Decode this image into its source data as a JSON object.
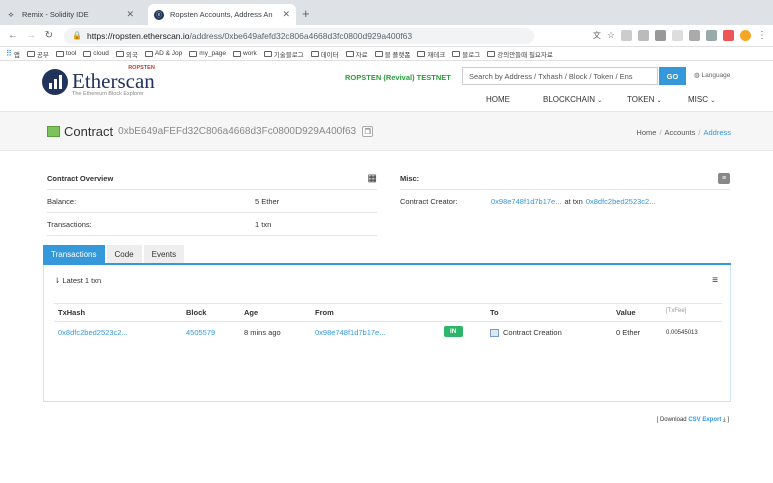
{
  "browser": {
    "tabs": [
      {
        "title": "Remix - Solidity IDE",
        "active": false
      },
      {
        "title": "Ropsten Accounts, Address An",
        "active": true
      }
    ],
    "url_host": "https://ropsten.etherscan.io",
    "url_path": "/address/0xbe649afefd32c806a4668d3fc0800d929a400f63",
    "bookmarks": [
      "앱",
      "공부",
      "tool",
      "cloud",
      "외국",
      "AD & Jop",
      "my_page",
      "work",
      "기술블로그",
      "데이터",
      "자료",
      "블 플랫폼",
      "재테크",
      "블로그",
      "강의만들때 필요자료"
    ]
  },
  "header": {
    "logo_badge": "ROPSTEN",
    "logo_name": "Etherscan",
    "logo_tagline": "The Ethereum Block Explorer",
    "network": "ROPSTEN (Revival) TESTNET",
    "search_placeholder": "Search by Address / Txhash / Block / Token / Ens",
    "go_label": "GO",
    "language": "Language",
    "nav": [
      "HOME",
      "BLOCKCHAIN",
      "TOKEN",
      "MISC"
    ]
  },
  "crumbbar": {
    "title": "Contract",
    "address": "0xbE649aFEFd32C806a4668d3Fc0800D929A400f63",
    "crumbs": [
      "Home",
      "Accounts",
      "Address"
    ]
  },
  "overview": {
    "title": "Contract Overview",
    "balance_label": "Balance:",
    "balance_value": "5 Ether",
    "tx_label": "Transactions:",
    "tx_value": "1 txn"
  },
  "misc": {
    "title": "Misc:",
    "creator_label": "Contract Creator:",
    "creator_addr": "0x98e748f1d7b17e...",
    "at_txn": "at txn",
    "creator_tx": "0x8dfc2bed2523c2..."
  },
  "tabs": [
    "Transactions",
    "Code",
    "Events"
  ],
  "txtable": {
    "latest": "Latest 1 txn",
    "headers": [
      "TxHash",
      "Block",
      "Age",
      "From",
      "To",
      "Value",
      "[TxFee]"
    ],
    "row": {
      "hash": "0x8dfc2bed2523c2...",
      "block": "4505579",
      "age": "8 mins ago",
      "from": "0x98e748f1d7b17e...",
      "direction": "IN",
      "to": "Contract Creation",
      "value": "0 Ether",
      "fee": "0.00545013"
    }
  },
  "download": {
    "prefix": "[ Download",
    "link": "CSV Export",
    "suffix": "]"
  }
}
